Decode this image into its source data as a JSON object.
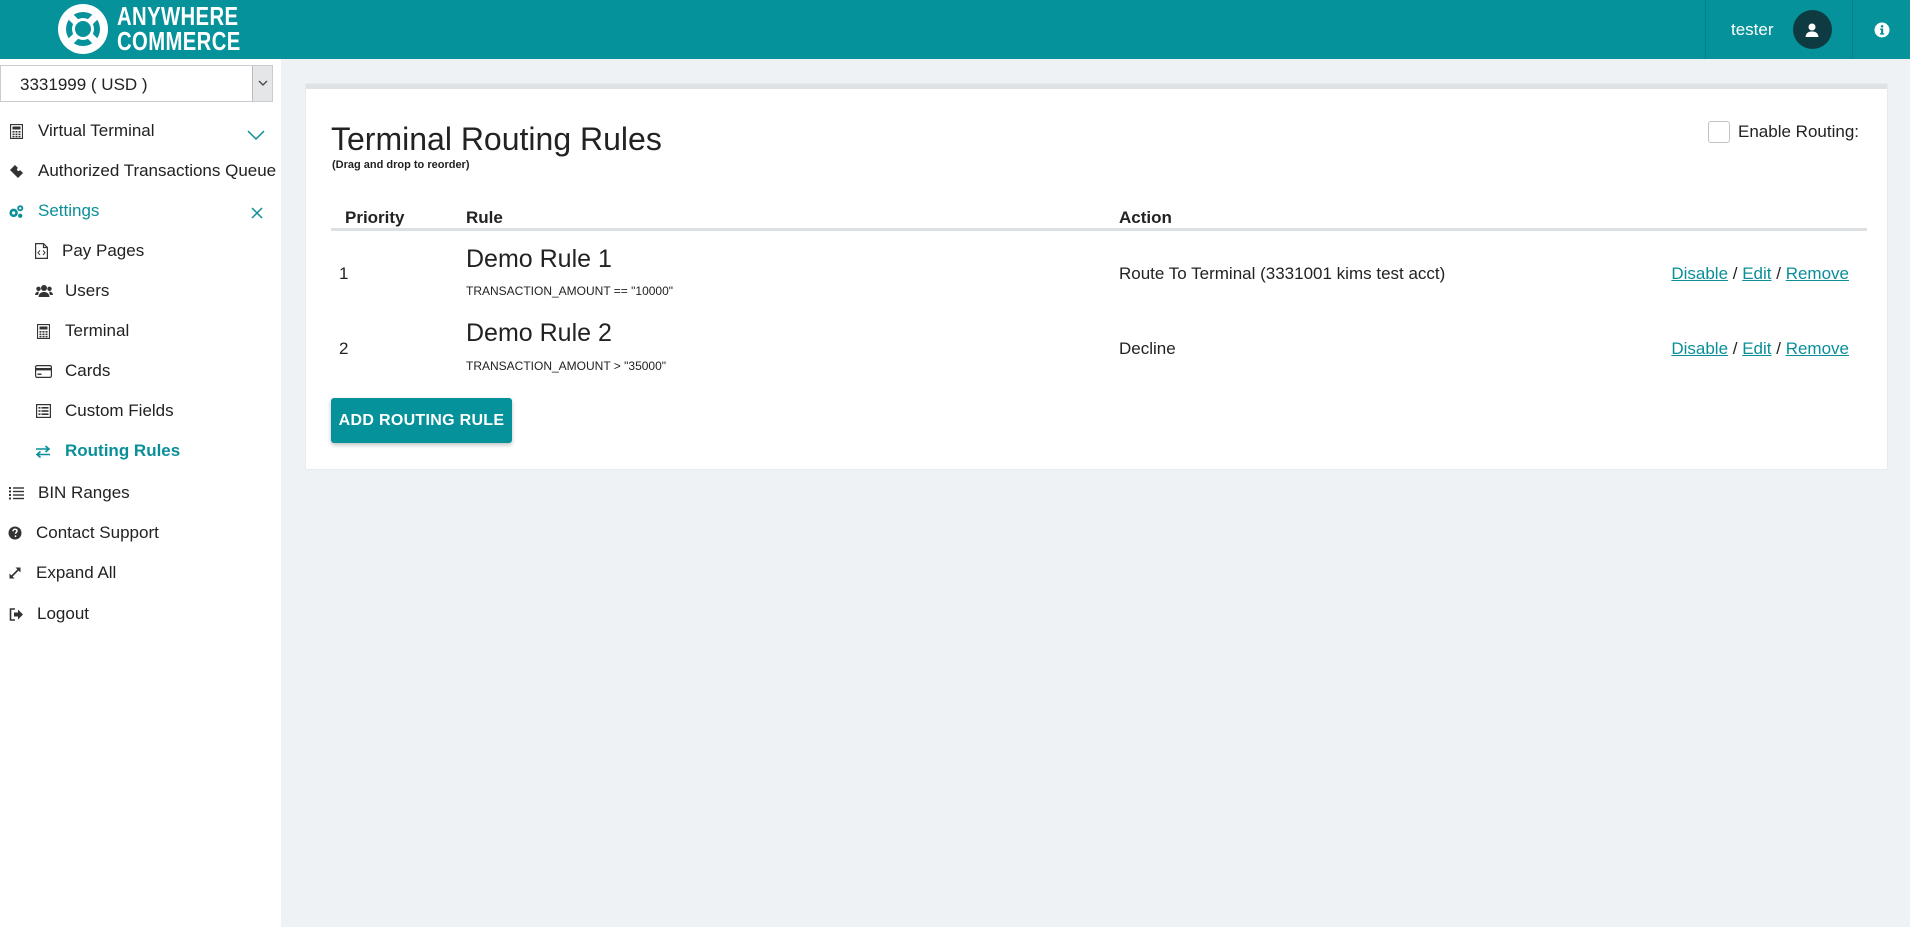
{
  "header": {
    "brand_line1": "ANYWHERE",
    "brand_line2": "COMMERCE",
    "username": "tester",
    "brand_color": "#05929a"
  },
  "sidebar": {
    "account": "3331999 ( USD )",
    "items": [
      {
        "label": "Virtual Terminal",
        "icon": "calculator-icon"
      },
      {
        "label": "Authorized Transactions Queue",
        "icon": "ticket-icon"
      },
      {
        "label": "Settings",
        "icon": "gears-icon"
      },
      {
        "label": "Pay Pages",
        "icon": "file-code-icon"
      },
      {
        "label": "Users",
        "icon": "users-icon"
      },
      {
        "label": "Terminal",
        "icon": "calculator-icon"
      },
      {
        "label": "Cards",
        "icon": "credit-card-icon"
      },
      {
        "label": "Custom Fields",
        "icon": "list-alt-icon"
      },
      {
        "label": "Routing Rules",
        "icon": "exchange-icon"
      },
      {
        "label": "BIN Ranges",
        "icon": "list-icon"
      },
      {
        "label": "Contact Support",
        "icon": "question-circle-icon"
      },
      {
        "label": "Expand All",
        "icon": "expand-icon"
      },
      {
        "label": "Logout",
        "icon": "sign-out-icon"
      }
    ]
  },
  "main": {
    "title": "Terminal Routing Rules",
    "subtitle": "(Drag and drop to reorder)",
    "enable_label": "Enable Routing:",
    "columns": {
      "priority": "Priority",
      "rule": "Rule",
      "action": "Action"
    },
    "rows": [
      {
        "priority": "1",
        "name": "Demo Rule 1",
        "expr": "TRANSACTION_AMOUNT == \"10000\"",
        "action": "Route To Terminal (3331001 kims test acct)",
        "disable": "Disable",
        "edit": "Edit",
        "remove": "Remove"
      },
      {
        "priority": "2",
        "name": "Demo Rule 2",
        "expr": "TRANSACTION_AMOUNT > \"35000\"",
        "action": "Decline",
        "disable": "Disable",
        "edit": "Edit",
        "remove": "Remove"
      }
    ],
    "add_button": "ADD ROUTING RULE"
  }
}
